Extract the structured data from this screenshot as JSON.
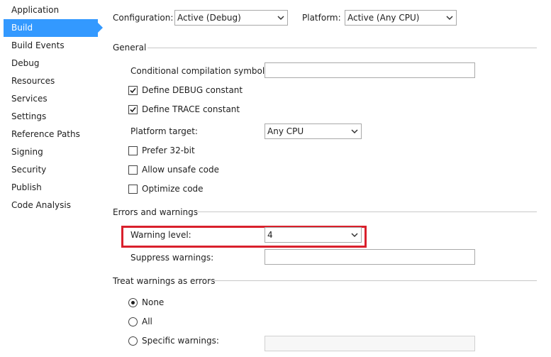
{
  "sidebar": {
    "items": [
      {
        "label": "Application"
      },
      {
        "label": "Build"
      },
      {
        "label": "Build Events"
      },
      {
        "label": "Debug"
      },
      {
        "label": "Resources"
      },
      {
        "label": "Services"
      },
      {
        "label": "Settings"
      },
      {
        "label": "Reference Paths"
      },
      {
        "label": "Signing"
      },
      {
        "label": "Security"
      },
      {
        "label": "Publish"
      },
      {
        "label": "Code Analysis"
      }
    ],
    "selected": "Build",
    "accent_color": "#3399ff"
  },
  "header": {
    "configuration_label": "Configuration:",
    "configuration_value": "Active (Debug)",
    "platform_label": "Platform:",
    "platform_value": "Active (Any CPU)"
  },
  "general": {
    "title": "General",
    "conditional_symbols_label": "Conditional compilation symbols:",
    "conditional_symbols_value": "",
    "define_debug": {
      "label": "Define DEBUG constant",
      "checked": true
    },
    "define_trace": {
      "label": "Define TRACE constant",
      "checked": true
    },
    "platform_target_label": "Platform target:",
    "platform_target_value": "Any CPU",
    "prefer_32bit": {
      "label": "Prefer 32-bit",
      "checked": false
    },
    "allow_unsafe": {
      "label": "Allow unsafe code",
      "checked": false
    },
    "optimize": {
      "label": "Optimize code",
      "checked": false
    }
  },
  "errors": {
    "title": "Errors and warnings",
    "warning_level_label": "Warning level:",
    "warning_level_value": "4",
    "suppress_label": "Suppress warnings:",
    "suppress_value": "",
    "highlight_color": "#d9202c"
  },
  "treat_warnings": {
    "title": "Treat warnings as errors",
    "options": [
      {
        "label": "None",
        "selected": true
      },
      {
        "label": "All",
        "selected": false
      },
      {
        "label": "Specific warnings:",
        "selected": false
      }
    ],
    "specific_value": ""
  }
}
